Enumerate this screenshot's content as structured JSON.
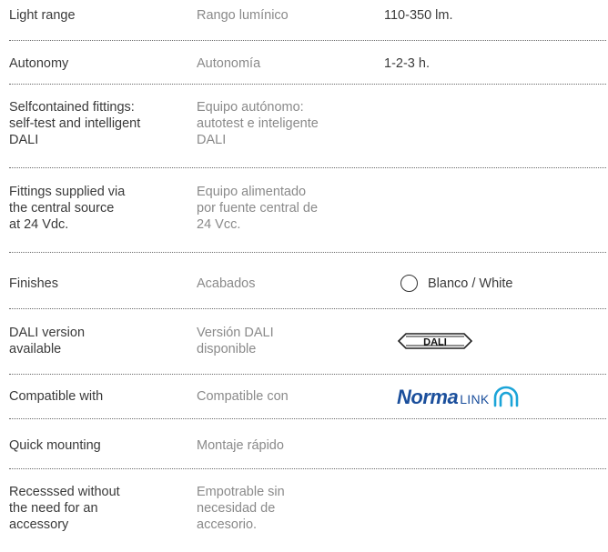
{
  "rows": [
    {
      "en": "Light range",
      "es": "Rango lumínico",
      "value": "110-350 lm."
    },
    {
      "en": "Autonomy",
      "es": "Autonomía",
      "value": "1-2-3 h."
    },
    {
      "en": "Selfcontained fittings:\nself-test and intelligent\nDALI",
      "es": "Equipo autónomo:\nautotest e inteligente\nDALI"
    },
    {
      "en": "Fittings supplied via\nthe central source\nat 24 Vdc.",
      "es": "Equipo alimentado\npor fuente central de\n24 Vcc."
    },
    {
      "en": "Finishes",
      "es": "Acabados",
      "finish_label": "Blanco / White",
      "finish_color": "#ffffff"
    },
    {
      "en": "DALI version\navailable",
      "es": "Versión DALI\ndisponible",
      "logo_text": "DALI"
    },
    {
      "en": "Compatible with",
      "es": "Compatible con",
      "brand_main": "Norma",
      "brand_sub": "LINK"
    },
    {
      "en": "Quick mounting",
      "es": "Montaje rápido"
    },
    {
      "en": "Recesssed without\nthe need for an\naccessory",
      "es": "Empotrable sin\nnecesidad de\naccesorio."
    }
  ],
  "colors": {
    "brand": "#1b4f9c",
    "text": "#3a3a3a",
    "secondary_text": "#8a8a8a"
  }
}
